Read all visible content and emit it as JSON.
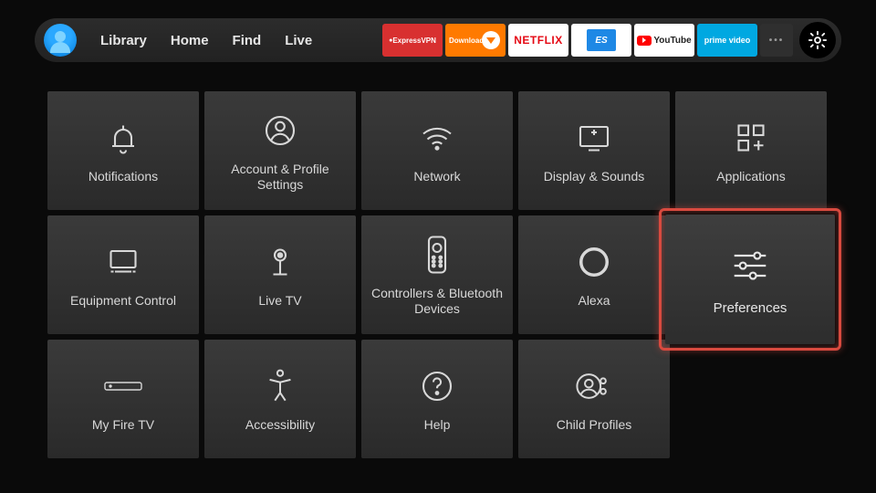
{
  "nav": {
    "library": "Library",
    "home": "Home",
    "find": "Find",
    "live": "Live"
  },
  "apps": {
    "express": "ExpressVPN",
    "downloader": "Downloader",
    "netflix": "NETFLIX",
    "es": "ES",
    "youtube": "YouTube",
    "prime": "prime video",
    "more": "•••"
  },
  "tiles": {
    "notifications": "Notifications",
    "account": "Account & Profile Settings",
    "network": "Network",
    "display": "Display & Sounds",
    "applications": "Applications",
    "equipment": "Equipment Control",
    "livetv": "Live TV",
    "controllers": "Controllers & Bluetooth Devices",
    "alexa": "Alexa",
    "preferences": "Preferences",
    "myfiretv": "My Fire TV",
    "accessibility": "Accessibility",
    "help": "Help",
    "childprofiles": "Child Profiles"
  }
}
